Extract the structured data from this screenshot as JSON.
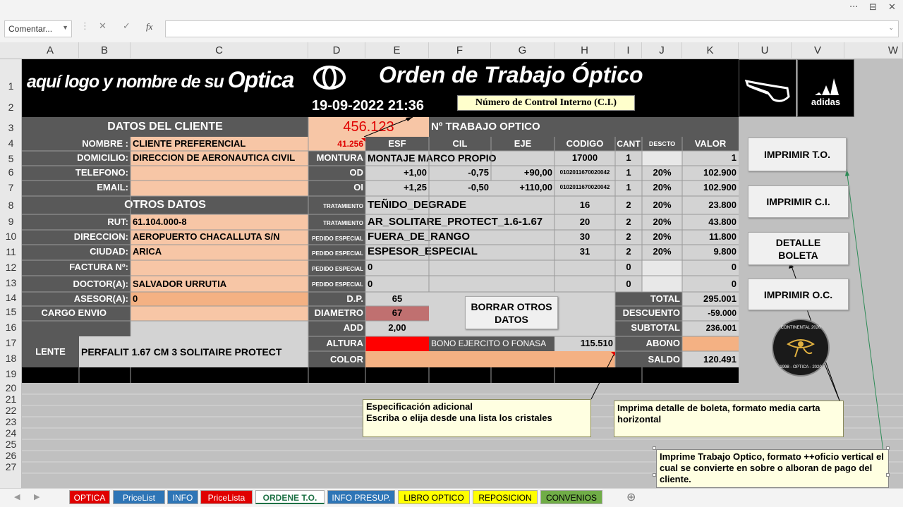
{
  "window": {
    "dots": "···",
    "restore": "⊟",
    "close": "✕"
  },
  "formula_bar": {
    "name_box": "Comentar...",
    "cancel": "✕",
    "enter": "✓",
    "fx": "fx",
    "value": ""
  },
  "columns": [
    "A",
    "B",
    "C",
    "D",
    "E",
    "F",
    "G",
    "H",
    "I",
    "J",
    "K",
    "U",
    "V",
    "W"
  ],
  "rows": [
    "1",
    "2",
    "3",
    "4",
    "5",
    "6",
    "7",
    "8",
    "9",
    "10",
    "11",
    "12",
    "13",
    "14",
    "15",
    "16",
    "17",
    "18",
    "19",
    "20",
    "21",
    "22",
    "23",
    "24",
    "25",
    "26",
    "27"
  ],
  "header": {
    "logo_text": "aquí logo y nombre de su",
    "optica": "Optica",
    "title": "Orden de Trabajo Óptico",
    "datetime": "19-09-2022 21:36",
    "ci_label": "Número de Control Interno (C.I.)",
    "brand": "adidas"
  },
  "client": {
    "section": "DATOS DEL CLIENTE",
    "nombre_label": "NOMBRE :",
    "nombre": "CLIENTE PREFERENCIAL",
    "domicilio_label": "DOMICILIO:",
    "domicilio": "DIRECCION DE AERONAUTICA CIVIL",
    "telefono_label": "TELEFONO:",
    "email_label": "EMAIL:"
  },
  "otros": {
    "section": "OTROS DATOS",
    "rut_label": "RUT:",
    "rut": "61.104.000-8",
    "direccion_label": "DIRECCION:",
    "direccion": "AEROPUERTO CHACALLUTA S/N",
    "ciudad_label": "CIUDAD:",
    "ciudad": "ARICA",
    "factura_label": "FACTURA Nº:",
    "doctor_label": "DOCTOR(A):",
    "doctor": "SALVADOR URRUTIA",
    "asesor_label": "ASESOR(A):",
    "asesor": "0",
    "cargo_label": "CARGO ENVIO"
  },
  "lente": {
    "label": "LENTE",
    "value": "PERFALIT 1.67 CM 3 SOLITAIRE PROTECT"
  },
  "order": {
    "number": "456.123",
    "trabajo_label": "Nº TRABAJO OPTICO",
    "d4": "41.256",
    "headers": [
      "ESF",
      "CIL",
      "EJE",
      "CODIGO",
      "CANT",
      "DESCTO",
      "VALOR"
    ],
    "montura_label": "MONTURA",
    "montura": "MONTAJE MARCO PROPIO",
    "montura_codigo": "17000",
    "montura_cant": "1",
    "montura_valor": "1",
    "od_label": "OD",
    "od": [
      "+1,00",
      "-0,75",
      "+90,00",
      "0102011670020042",
      "1",
      "20%",
      "102.900"
    ],
    "oi_label": "OI",
    "oi": [
      "+1,25",
      "-0,50",
      "+110,00",
      "0102011670020042",
      "1",
      "20%",
      "102.900"
    ],
    "items": [
      {
        "label": "TRATAMIENTO",
        "name": "TEÑIDO_DEGRADE",
        "code": "16",
        "cant": "2",
        "desc": "20%",
        "valor": "23.800"
      },
      {
        "label": "TRATAMIENTO",
        "name": "AR_SOLITARE_PROTECT_1.6-1.67",
        "code": "20",
        "cant": "2",
        "desc": "20%",
        "valor": "43.800"
      },
      {
        "label": "PEDIDO ESPECIAL",
        "name": "FUERA_DE_RANGO",
        "code": "30",
        "cant": "2",
        "desc": "20%",
        "valor": "11.800"
      },
      {
        "label": "PEDIDO ESPECIAL",
        "name": "ESPESOR_ESPECIAL",
        "code": "31",
        "cant": "2",
        "desc": "20%",
        "valor": "9.800"
      },
      {
        "label": "PEDIDO ESPECIAL",
        "name": "0",
        "code": "",
        "cant": "0",
        "desc": "",
        "valor": "0"
      },
      {
        "label": "PEDIDO ESPECIAL",
        "name": "0",
        "code": "",
        "cant": "0",
        "desc": "",
        "valor": "0"
      }
    ],
    "dp_label": "D.P.",
    "dp": "65",
    "diametro_label": "DIAMETRO",
    "diametro": "67",
    "add_label": "ADD",
    "add": "2,00",
    "altura_label": "ALTURA",
    "color_label": "COLOR",
    "bono_label": "BONO EJERCITO O FONASA",
    "bono": "115.510",
    "total_label": "TOTAL",
    "total": "295.001",
    "descuento_label": "DESCUENTO",
    "descuento": "-59.000",
    "subtotal_label": "SUBTOTAL",
    "subtotal": "236.001",
    "abono_label": "ABONO",
    "saldo_label": "SALDO",
    "saldo": "120.491"
  },
  "buttons": {
    "imprimir_to": "IMPRIMIR T.O.",
    "imprimir_ci": "IMPRIMIR C.I.",
    "detalle_boleta": "DETALLE BOLETA",
    "imprimir_oc": "IMPRIMIR O.C.",
    "borrar": "BORRAR OTROS DATOS"
  },
  "seal": {
    "top": "CONTINENTAL 2020",
    "bottom": "1998 - OPTICA - 2020"
  },
  "notes": {
    "n1_line1": "Especificación adicional",
    "n1_line2": "Escriba o elija desde una lista los cristales",
    "n2": "Imprima detalle de boleta, formato media carta horizontal",
    "n3": "Imprime Trabajo Optico, formato ++oficio vertical el cual se convierte en sobre o alboran de pago del cliente."
  },
  "tabs": [
    {
      "label": "OPTICA",
      "color": "#e00000"
    },
    {
      "label": "PriceList",
      "color": "#2e75b6"
    },
    {
      "label": "INFO",
      "color": "#2e75b6"
    },
    {
      "label": "PriceLista",
      "color": "#e00000"
    },
    {
      "label": "ORDENE T.O.",
      "color": "#ffffff",
      "active": true
    },
    {
      "label": "INFO PRESUP.",
      "color": "#2e75b6"
    },
    {
      "label": "LIBRO OPTICO",
      "color": "#ffff00"
    },
    {
      "label": "REPOSICION",
      "color": "#ffff00"
    },
    {
      "label": "CONVENIOS",
      "color": "#70ad47"
    }
  ],
  "add_sheet": "⊕"
}
